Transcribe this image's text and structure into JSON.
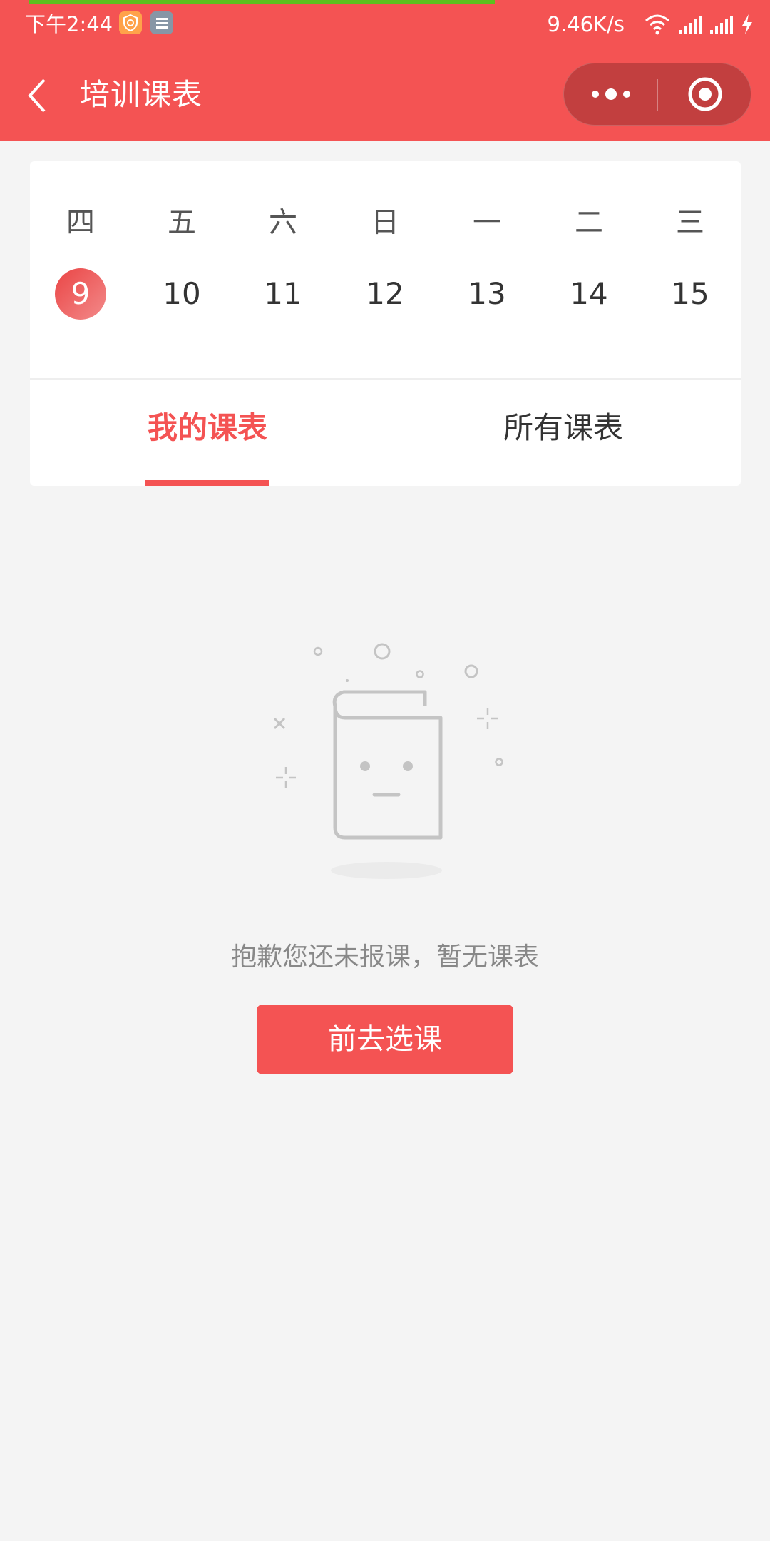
{
  "status_bar": {
    "time": "下午2:44",
    "net_speed": "9.46K/s",
    "icons": [
      "shield-icon",
      "mail-icon",
      "wifi-icon",
      "signal-icon",
      "signal-icon",
      "charging-icon"
    ]
  },
  "nav": {
    "title": "培训课表",
    "back_icon": "chevron-left-icon",
    "capsule": {
      "more_icon": "more-dots-icon",
      "close_icon": "target-icon"
    }
  },
  "calendar": {
    "weekdays": [
      "四",
      "五",
      "六",
      "日",
      "一",
      "二",
      "三"
    ],
    "dates": [
      "9",
      "10",
      "11",
      "12",
      "13",
      "14",
      "15"
    ],
    "selected_date": "9"
  },
  "tabs": [
    {
      "label": "我的课表",
      "active": true
    },
    {
      "label": "所有课表",
      "active": false
    }
  ],
  "empty_state": {
    "icon": "book-face-icon",
    "message": "抱歉您还未报课，暂无课表",
    "button_label": "前去选课"
  },
  "colors": {
    "primary": "#f45353",
    "header_bg": "#f45353",
    "capsule_bg": "#c23f3f",
    "page_bg": "#f4f4f4",
    "progress": "#5cc01e"
  }
}
